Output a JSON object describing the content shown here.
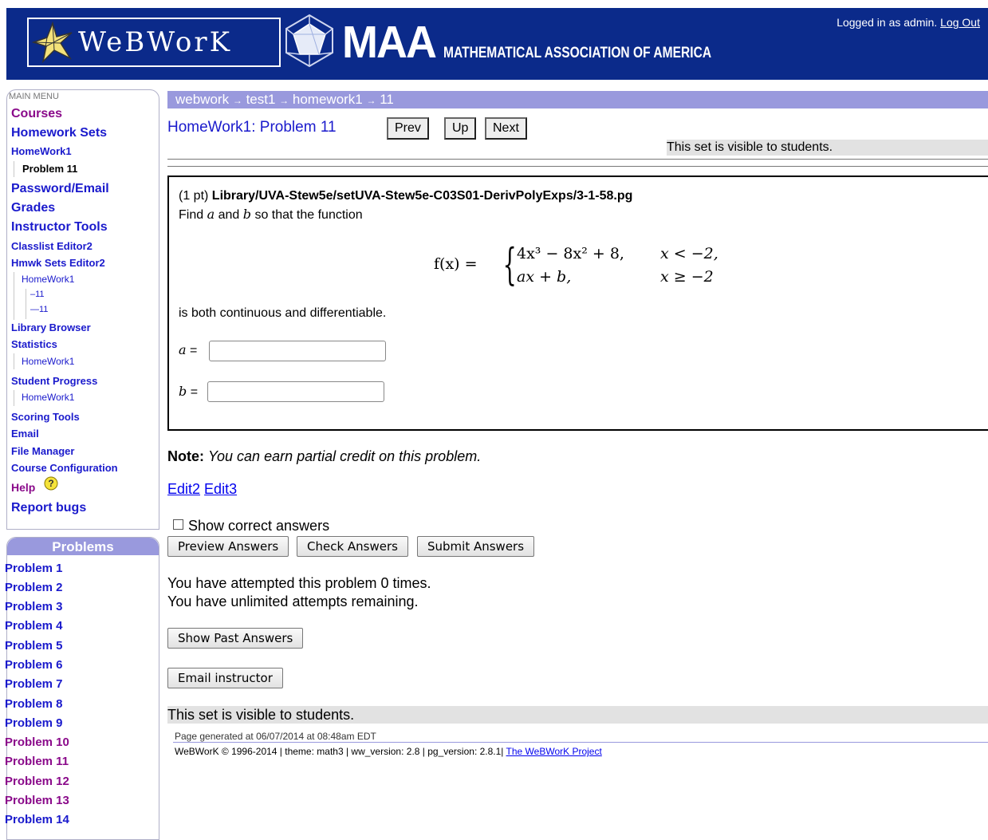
{
  "header": {
    "webwork_logo_text": "WeBWorK",
    "maa_big": "MAA",
    "maa_small": "MATHEMATICAL ASSOCIATION OF AMERICA",
    "login_text": "Logged in as admin.",
    "logout_label": "Log Out",
    "bg_color": "#0b2a8a"
  },
  "sidebar": {
    "main_menu_title": "MAIN MENU",
    "courses": "Courses",
    "homework_sets": "Homework Sets",
    "homework1": "HomeWork1",
    "problem11": "Problem 11",
    "password_email": "Password/Email",
    "grades": "Grades",
    "instructor_tools": "Instructor Tools",
    "classlist_editor2": "Classlist Editor2",
    "hmwk_sets_editor2": "Hmwk Sets Editor2",
    "hmwk_sub_homework1": "HomeWork1",
    "hmwk_sub_11a": "–11",
    "hmwk_sub_11b": "—11",
    "library_browser": "Library Browser",
    "statistics": "Statistics",
    "stats_sub_homework1": "HomeWork1",
    "student_progress": "Student Progress",
    "progress_sub_homework1": "HomeWork1",
    "scoring_tools": "Scoring Tools",
    "email": "Email",
    "file_manager": "File Manager",
    "course_configuration": "Course Configuration",
    "help": "Help",
    "report_bugs": "Report bugs"
  },
  "problems_panel": {
    "title": "Problems",
    "items": [
      "Problem 1",
      "Problem 2",
      "Problem 3",
      "Problem 4",
      "Problem 5",
      "Problem 6",
      "Problem 7",
      "Problem 8",
      "Problem 9",
      "Problem 10",
      "Problem 11",
      "Problem 12",
      "Problem 13",
      "Problem 14"
    ]
  },
  "breadcrumb": {
    "items": [
      "webwork",
      "test1",
      "homework1",
      "11"
    ],
    "separator": "→"
  },
  "problem_header": {
    "title": "HomeWork1: Problem 11",
    "prev": "Prev",
    "up": "Up",
    "next": "Next",
    "visibility": "This set is visible to students."
  },
  "problem": {
    "points": "(1 pt)",
    "path": "Library/UVA-Stew5e/setUVA-Stew5e-C03S01-DerivPolyExps/3-1-58.pg",
    "find_prefix": "Find",
    "var_a": "a",
    "and": "and",
    "var_b": "b",
    "find_suffix": "so that the function",
    "fx": "f(x) =",
    "case1_expr": "4x³ − 8x² + 8,",
    "case1_cond": "x < −2,",
    "case2_expr": "ax + b,",
    "case2_cond": "x ≥ −2",
    "statement": "is both continuous and differentiable.",
    "a_label_suffix": "=",
    "b_label_suffix": "=",
    "a_value": "",
    "b_value": ""
  },
  "note": {
    "label": "Note:",
    "text": "You can earn partial credit on this problem."
  },
  "edit_links": [
    "Edit2",
    "Edit3"
  ],
  "actions": {
    "show_correct_label": "Show correct answers",
    "show_correct_checked": false,
    "preview": "Preview Answers",
    "check": "Check Answers",
    "submit": "Submit Answers"
  },
  "attempts": {
    "line1": "You have attempted this problem 0 times.",
    "line2": "You have unlimited attempts remaining."
  },
  "show_past_answers": "Show Past Answers",
  "email_instructor": "Email instructor",
  "visibility_footer": "This set is visible to students.",
  "footer": {
    "generated": "Page generated at 06/07/2014 at 08:48am EDT",
    "copyright": "WeBWorK © 1996-2014 | theme: math3 | ww_version: 2.8 | pg_version: 2.8.1|",
    "project_link": "The WeBWorK Project"
  }
}
